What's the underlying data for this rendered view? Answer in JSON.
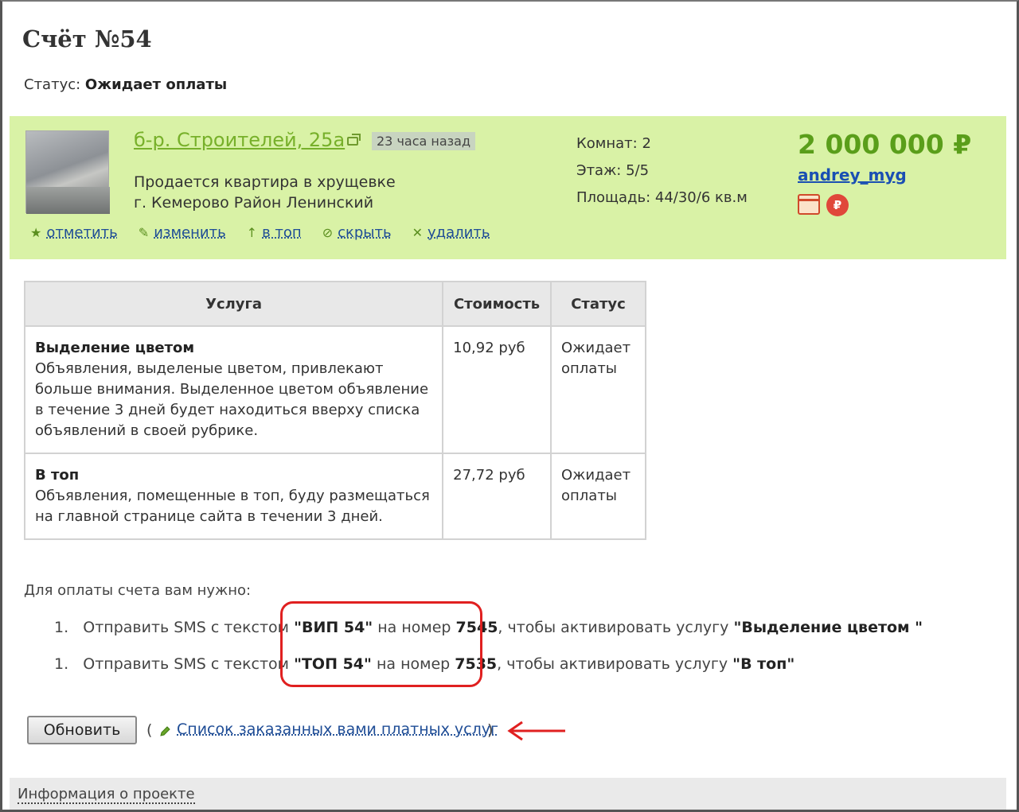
{
  "invoice": {
    "title": "Счёт №54",
    "status_label": "Статус: ",
    "status_value": "Ожидает оплаты"
  },
  "ad": {
    "address": "б-р. Строителей, 25а",
    "time_ago": "23 часа назад",
    "description_line1": "Продается квартира в хрущевке",
    "description_line2": "г. Кемерово Район Ленинский",
    "rooms": "Комнат: 2",
    "floor": "Этаж: 5/5",
    "area": "Площадь: 44/30/6 кв.м",
    "price": "2 000 000 ₽",
    "user": "andrey_myg",
    "rub_symbol": "₽",
    "actions": [
      {
        "icon": "star-icon",
        "glyph": "★",
        "label": "отметить"
      },
      {
        "icon": "edit-icon",
        "glyph": "✎",
        "label": "изменить"
      },
      {
        "icon": "arrow-up-icon",
        "glyph": "↑",
        "label": "в топ"
      },
      {
        "icon": "hide-icon",
        "glyph": "⊘",
        "label": "скрыть"
      },
      {
        "icon": "delete-icon",
        "glyph": "✕",
        "label": "удалить"
      }
    ]
  },
  "services_table": {
    "headers": [
      "Услуга",
      "Стоимость",
      "Статус"
    ],
    "rows": [
      {
        "name": "Выделение цветом",
        "description": "Объявления, выделеные цветом, привлекают больше внимания. Выделенное цветом объявление в течение 3 дней будет находиться вверху списка объявлений в своей рубрике.",
        "price": "10,92 руб",
        "status": "Ожидает оплаты"
      },
      {
        "name": "В топ",
        "description": "Объявления, помещенные в топ, буду размещаться на главной странице сайта в течении 3 дней.",
        "price": "27,72 руб",
        "status": "Ожидает оплаты"
      }
    ]
  },
  "payment": {
    "intro": "Для оплаты счета вам нужно:",
    "steps": [
      {
        "num": "1.",
        "prefix": "Отправить SMS с текстом ",
        "code": "\"ВИП 54\"",
        "mid": " на номер ",
        "number": "7545",
        "suffix": ", чтобы активировать услугу ",
        "service": "\"Выделение цветом \""
      },
      {
        "num": "1.",
        "prefix": "Отправить SMS с текстом ",
        "code": "\"ТОП 54\"",
        "mid": " на номер ",
        "number": "7535",
        "suffix": ", чтобы активировать услугу ",
        "service": "\"В топ\""
      }
    ]
  },
  "controls": {
    "refresh_label": "Обновить",
    "paren_open": "(",
    "paren_close": ")",
    "services_list_link": "Список заказанных вами платных услуг"
  },
  "footer": {
    "link": "Информация о проекте"
  },
  "colors": {
    "ad_background": "#d9f2a6",
    "price_green": "#5a9e1a",
    "link_blue": "#1f4d96",
    "highlight_red": "#e02020"
  }
}
